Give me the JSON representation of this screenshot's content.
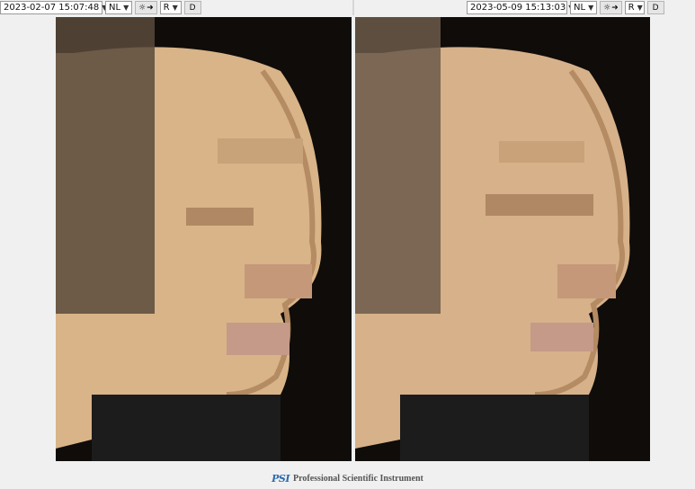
{
  "panels": [
    {
      "timestamp": "2023-02-07 15:07:48",
      "mode": "NL",
      "side": "R",
      "d_label": "D"
    },
    {
      "timestamp": "2023-05-09 15:13:03",
      "mode": "NL",
      "side": "R",
      "d_label": "D"
    }
  ],
  "icons": {
    "light": "sun-icon",
    "arrow": "arrow-right-icon",
    "dropdown": "chevron-down-icon"
  },
  "footer": {
    "logo": "PSI",
    "company": "Professional Scientific Instrument"
  }
}
